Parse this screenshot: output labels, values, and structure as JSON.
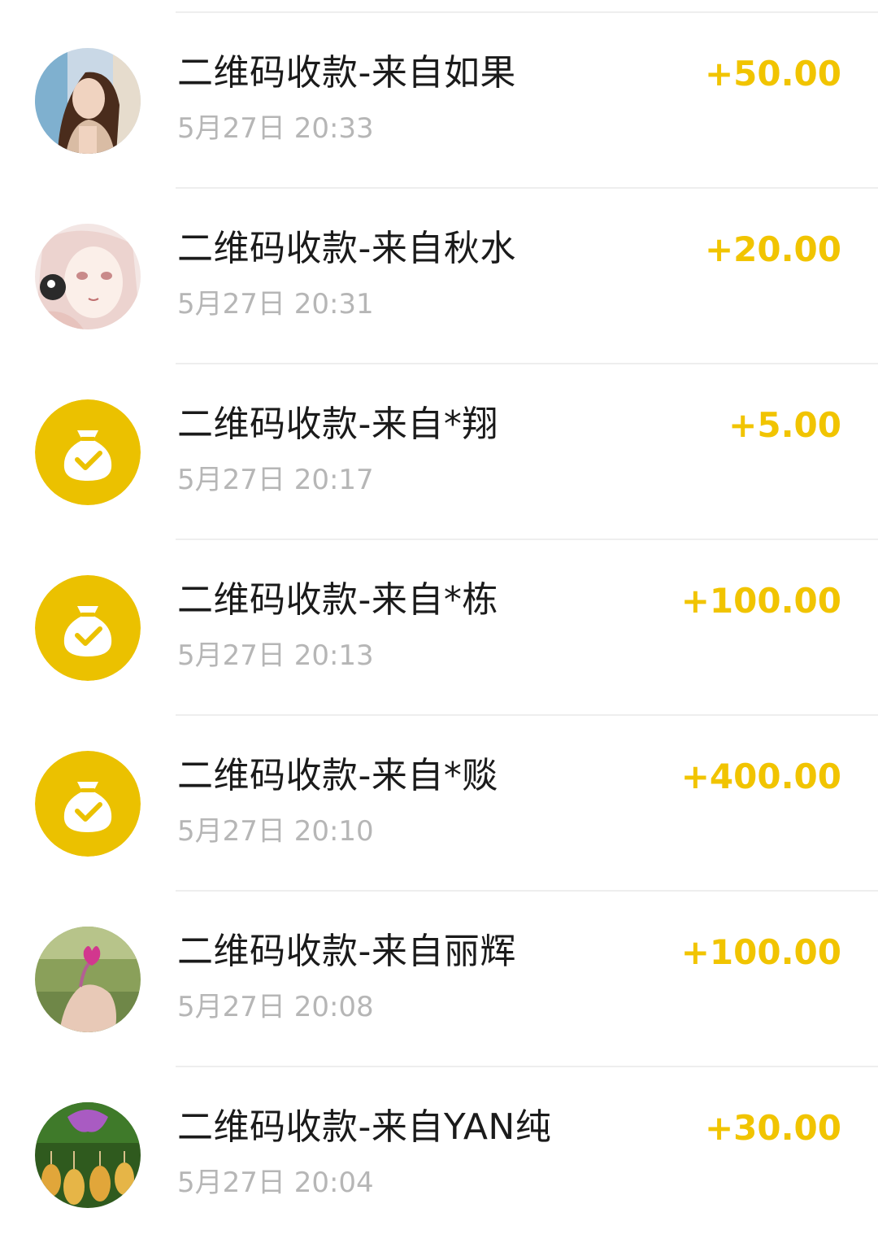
{
  "colors": {
    "amount": "#f1c400",
    "title": "#1b1b1b",
    "time": "#b6b6b6",
    "divider": "#eeeeee",
    "moneybag_bg": "#ebc100"
  },
  "transactions": [
    {
      "title": "二维码收款-来自如果",
      "time": "5月27日 20:33",
      "amount": "+50.00",
      "avatar": "photo-woman-avatar"
    },
    {
      "title": "二维码收款-来自秋水",
      "time": "5月27日 20:31",
      "amount": "+20.00",
      "avatar": "anime-girl-avatar"
    },
    {
      "title": "二维码收款-来自*翔",
      "time": "5月27日 20:17",
      "amount": "+5.00",
      "avatar": "money-bag-icon"
    },
    {
      "title": "二维码收款-来自*栋",
      "time": "5月27日 20:13",
      "amount": "+100.00",
      "avatar": "money-bag-icon"
    },
    {
      "title": "二维码收款-来自*赕",
      "time": "5月27日 20:10",
      "amount": "+400.00",
      "avatar": "money-bag-icon"
    },
    {
      "title": "二维码收款-来自丽辉",
      "time": "5月27日 20:08",
      "amount": "+100.00",
      "avatar": "photo-hand-flower-avatar"
    },
    {
      "title": "二维码收款-来自YAN纯",
      "time": "5月27日 20:04",
      "amount": "+30.00",
      "avatar": "photo-lanterns-avatar"
    }
  ]
}
